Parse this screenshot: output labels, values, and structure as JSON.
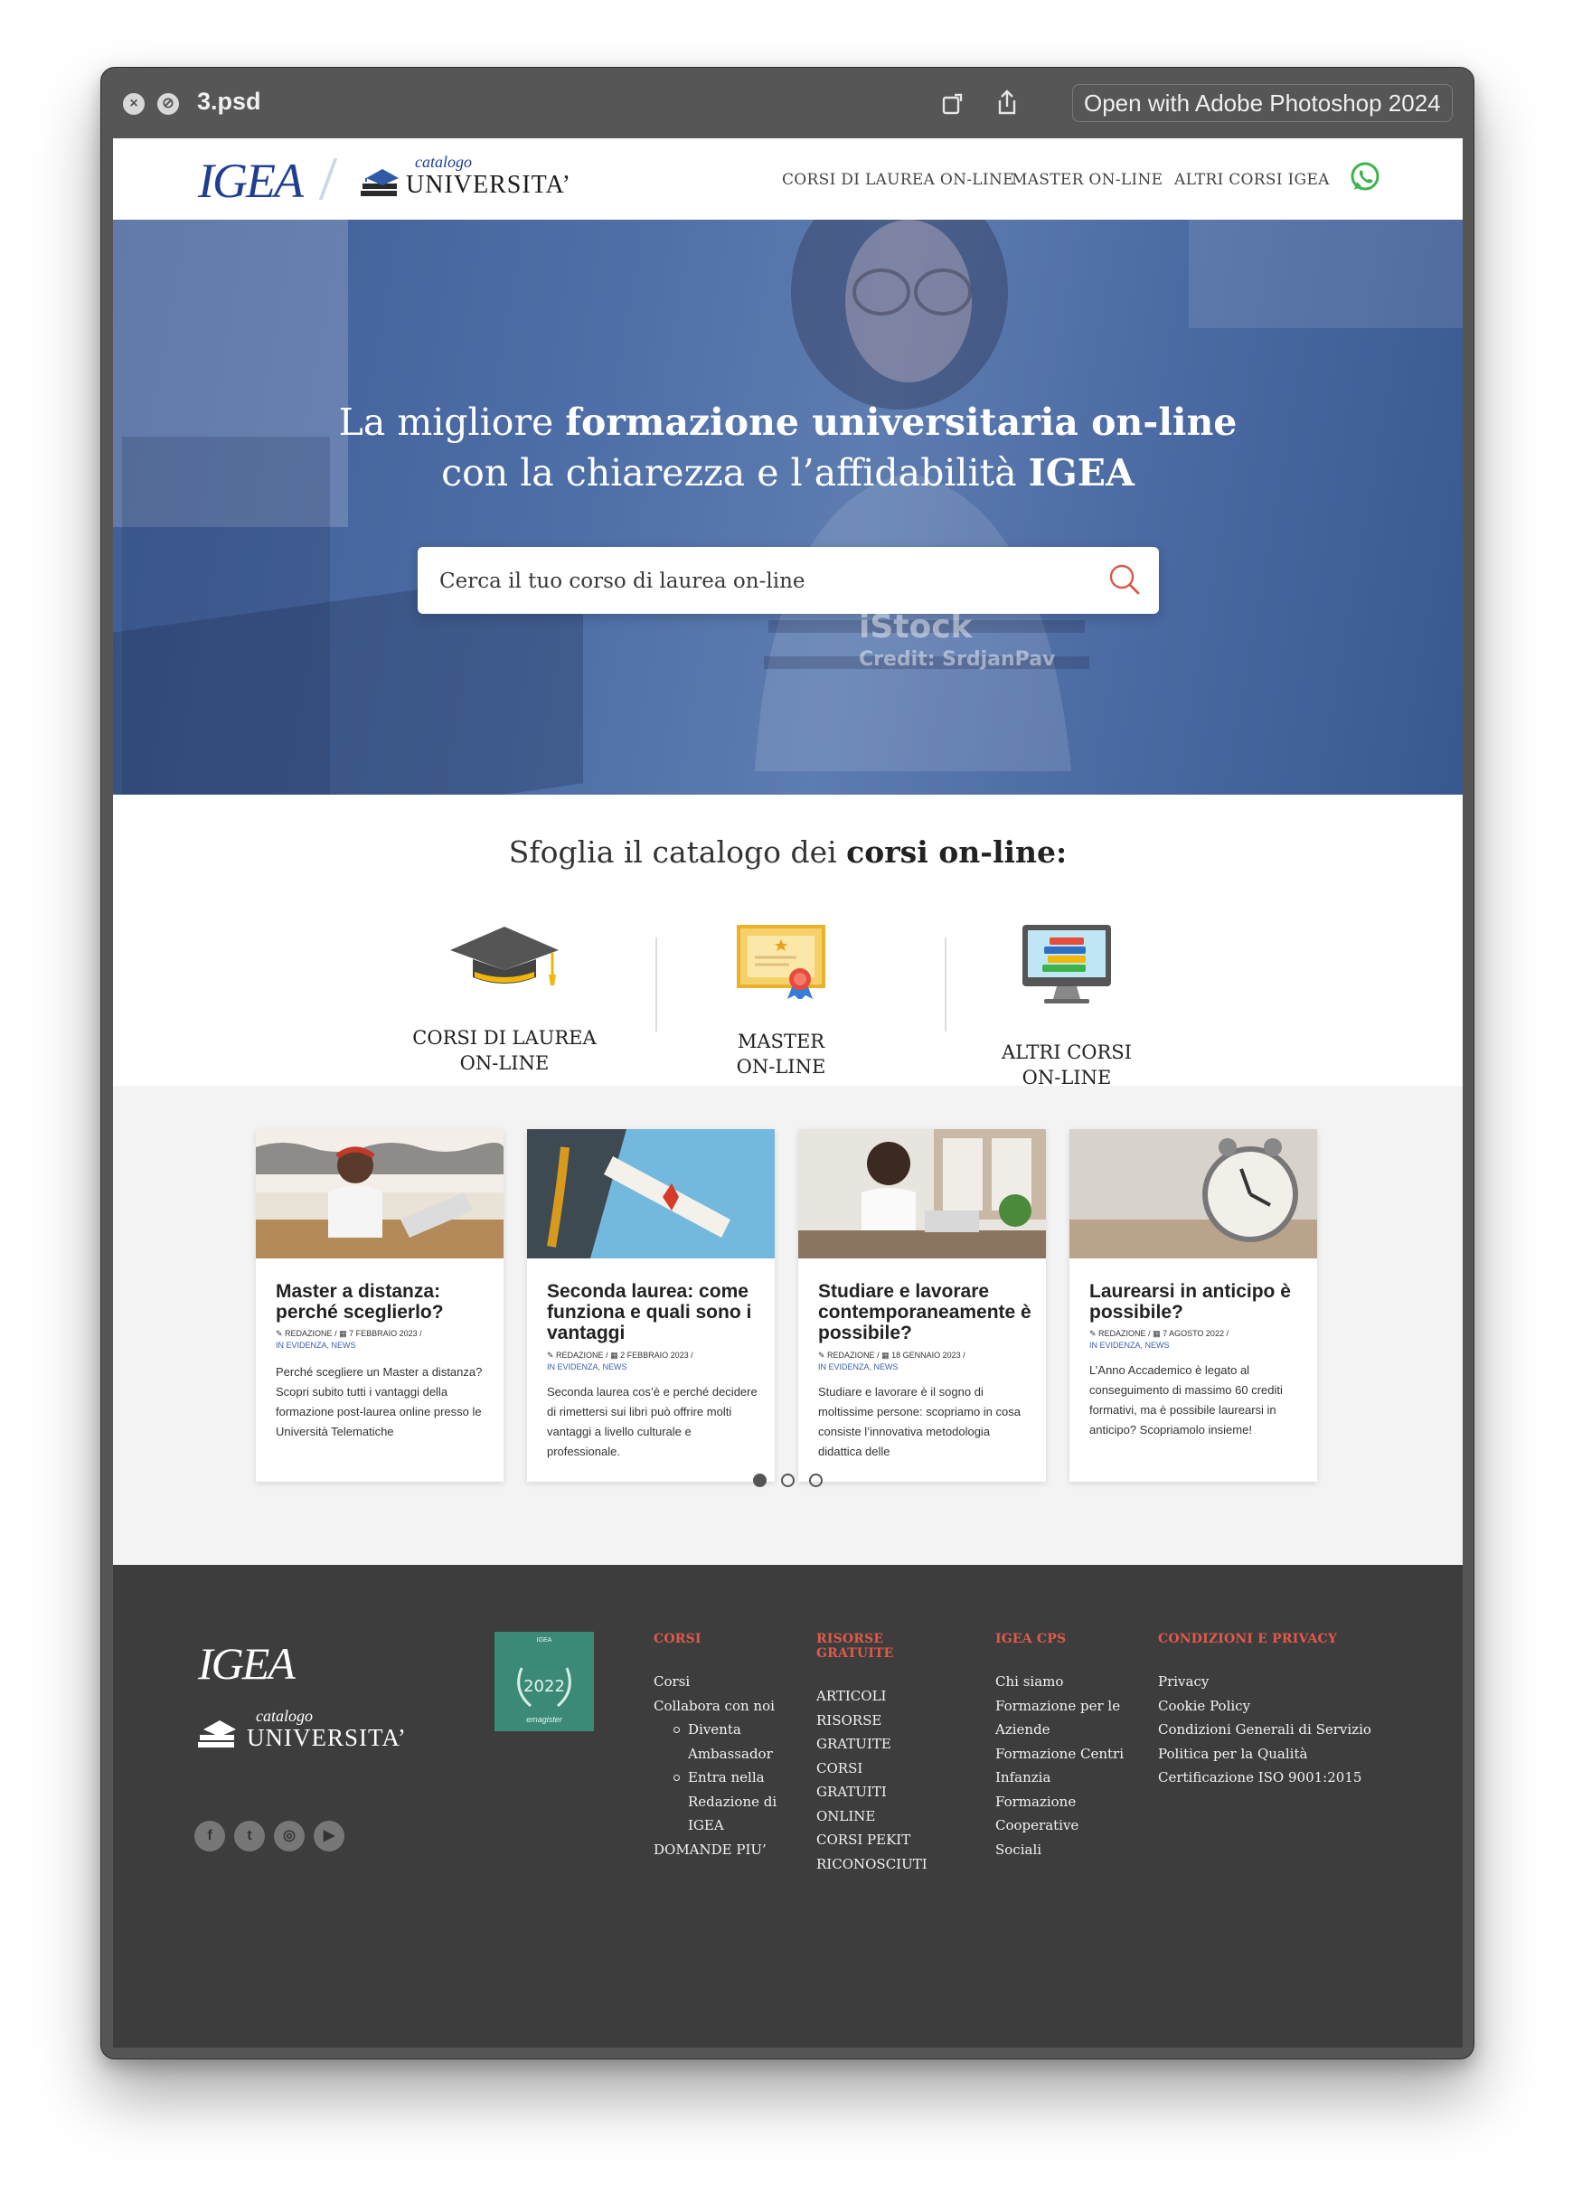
{
  "window": {
    "title": "3.psd",
    "open_with": "Open with Adobe Photoshop 2024"
  },
  "header": {
    "logo_igea": "IGEA",
    "logo_catalogo": "catalogo",
    "logo_universita": "UNIVERSITA’",
    "nav": [
      "CORSI DI LAUREA ON-LINE",
      "MASTER ON-LINE",
      "ALTRI CORSI IGEA"
    ]
  },
  "hero": {
    "line1_light": "La migliore ",
    "line1_bold": "formazione universitaria on-line",
    "line2_light": "con la chiarezza e l’affidabilità ",
    "line2_bold": "IGEA",
    "search_placeholder": "Cerca il tuo corso di laurea on-line",
    "watermark": "iStock",
    "credit": "Credit: SrdjanPav"
  },
  "catalog": {
    "title_light": "Sfoglia il catalogo dei ",
    "title_bold": "corsi on-line:",
    "items": [
      {
        "line1": "CORSI DI LAUREA",
        "line2": "ON-LINE",
        "icon": "graduation-cap-icon"
      },
      {
        "line1": "MASTER",
        "line2": "ON-LINE",
        "icon": "certificate-icon"
      },
      {
        "line1": "ALTRI  CORSI",
        "line2": "ON-LINE",
        "icon": "computer-books-icon"
      }
    ]
  },
  "news": {
    "cards": [
      {
        "title": "Master a distanza: perché sceglierlo?",
        "author": "REDAZIONE",
        "date": "7 FEBBRAIO 2023",
        "tags": "IN EVIDENZA, NEWS",
        "excerpt": "Perché scegliere un Master a distanza? Scopri subito tutti i vantaggi della formazione post-laurea online presso le Università Telematiche"
      },
      {
        "title": "Seconda laurea: come funziona e quali sono i vantaggi",
        "author": "REDAZIONE",
        "date": "2 FEBBRAIO 2023",
        "tags": "IN EVIDENZA, NEWS",
        "excerpt": "Seconda laurea cos’è e perché decidere di rimettersi sui libri può offrire molti vantaggi a livello culturale e professionale."
      },
      {
        "title": "Studiare e lavorare contemporaneamente è possibile?",
        "author": "REDAZIONE",
        "date": "18 GENNAIO 2023",
        "tags": "IN EVIDENZA, NEWS",
        "excerpt": "Studiare e lavorare è il sogno di moltissime persone: scopriamo in cosa consiste l’innovativa metodologia didattica delle"
      },
      {
        "title": "Laurearsi in anticipo è possibile?",
        "author": "REDAZIONE",
        "date": "7 AGOSTO 2022",
        "tags": "IN EVIDENZA, NEWS",
        "excerpt": "L’Anno Accademico è legato al conseguimento di massimo 60 crediti formativi, ma è possibile laurearsi in anticipo? Scopriamolo insieme!"
      }
    ],
    "active_dot": 1,
    "dot_count": 3
  },
  "footer": {
    "logo_igea": "IGEA",
    "logo_catalogo": "catalogo",
    "logo_universita": "UNIVERSITA’",
    "badge_top": "IGEA",
    "badge_year": "2022",
    "badge_bottom": "emagister",
    "social": [
      "facebook-icon",
      "twitter-icon",
      "instagram-icon",
      "youtube-icon"
    ],
    "col_corsi": {
      "heading": "CORSI",
      "links": [
        "Corsi",
        "Collabora con noi"
      ],
      "sublinks": [
        "Diventa Ambassador",
        "Entra nella Redazione di IGEA"
      ],
      "last": "DOMANDE PIU’"
    },
    "col_risorse": {
      "heading": "RISORSE GRATUITE",
      "links": [
        "ARTICOLI",
        "RISORSE",
        "GRATUITE",
        "CORSI GRATUITI",
        "ONLINE",
        "CORSI PEKIT",
        "RICONOSCIUTI"
      ]
    },
    "col_cps": {
      "heading": "IGEA CPS",
      "links": [
        "Chi siamo",
        "Formazione per le",
        "Aziende",
        "Formazione Centri",
        "Infanzia",
        "Formazione",
        "Cooperative",
        "Sociali"
      ]
    },
    "col_privacy": {
      "heading": "CONDIZIONI E PRIVACY",
      "links": [
        "Privacy",
        "Cookie Policy",
        "Condizioni Generali di Servizio",
        "Politica per la Qualità",
        "Certificazione ISO 9001:2015"
      ]
    }
  }
}
